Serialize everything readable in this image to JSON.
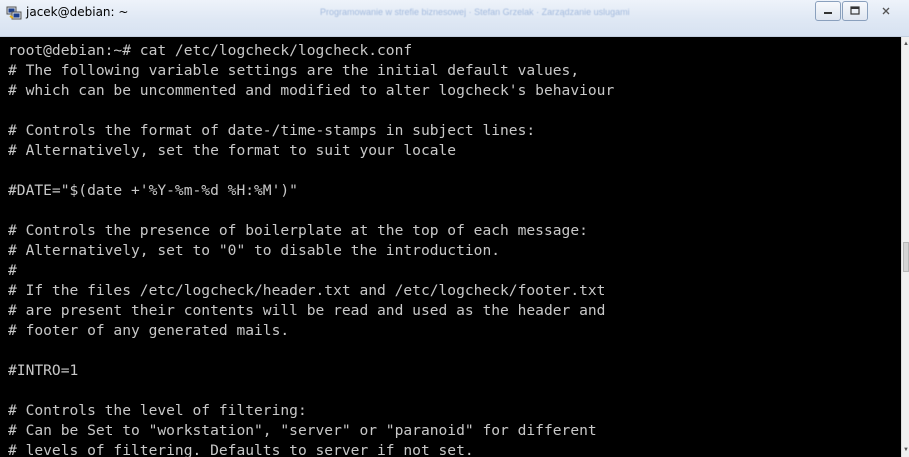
{
  "window": {
    "title": "jacek@debian: ~",
    "icon": "putty-icon",
    "controls": {
      "minimize": "minimize-icon",
      "maximize": "maximize-icon",
      "close": "close-icon"
    },
    "background_window_text": "Programowanie w strefie biznesowej · Stefan Grzelak · Zarządzanie uslugami"
  },
  "terminal": {
    "background": "#000000",
    "foreground": "#c8c8c8",
    "lines": [
      "root@debian:~# cat /etc/logcheck/logcheck.conf",
      "# The following variable settings are the initial default values,",
      "# which can be uncommented and modified to alter logcheck's behaviour",
      "",
      "# Controls the format of date-/time-stamps in subject lines:",
      "# Alternatively, set the format to suit your locale",
      "",
      "#DATE=\"$(date +'%Y-%m-%d %H:%M')\"",
      "",
      "# Controls the presence of boilerplate at the top of each message:",
      "# Alternatively, set to \"0\" to disable the introduction.",
      "#",
      "# If the files /etc/logcheck/header.txt and /etc/logcheck/footer.txt",
      "# are present their contents will be read and used as the header and",
      "# footer of any generated mails.",
      "",
      "#INTRO=1",
      "",
      "# Controls the level of filtering:",
      "# Can be Set to \"workstation\", \"server\" or \"paranoid\" for different",
      "# levels of filtering. Defaults to server if not set."
    ]
  },
  "scrollbar": {
    "up": "scroll-up-icon",
    "down": "scroll-down-icon"
  }
}
